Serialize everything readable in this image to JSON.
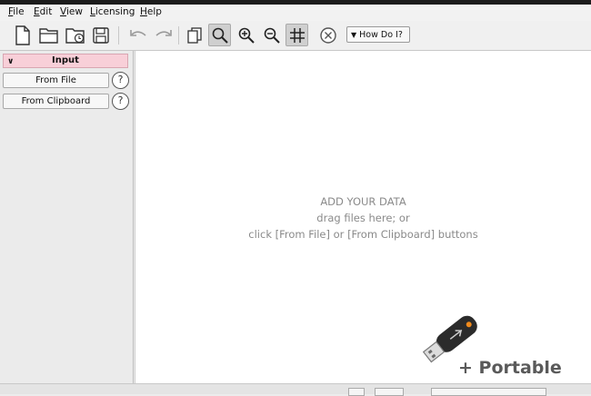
{
  "menu": {
    "items": [
      {
        "key": "F",
        "rest": "ile"
      },
      {
        "key": "E",
        "rest": "dit"
      },
      {
        "key": "V",
        "rest": "iew"
      },
      {
        "key": "L",
        "rest": "icensing"
      },
      {
        "key": "H",
        "rest": "elp"
      }
    ]
  },
  "toolbar": {
    "how_do_i_label": "How Do I?"
  },
  "input_panel": {
    "header_label": "Input",
    "from_file_label": "From File",
    "from_clipboard_label": "From Clipboard",
    "help_glyph": "?"
  },
  "main": {
    "line1": "ADD YOUR DATA",
    "line2": "drag files here; or",
    "line3": "click [From File] or [From Clipboard] buttons"
  },
  "badge": {
    "label": "+ Portable"
  }
}
